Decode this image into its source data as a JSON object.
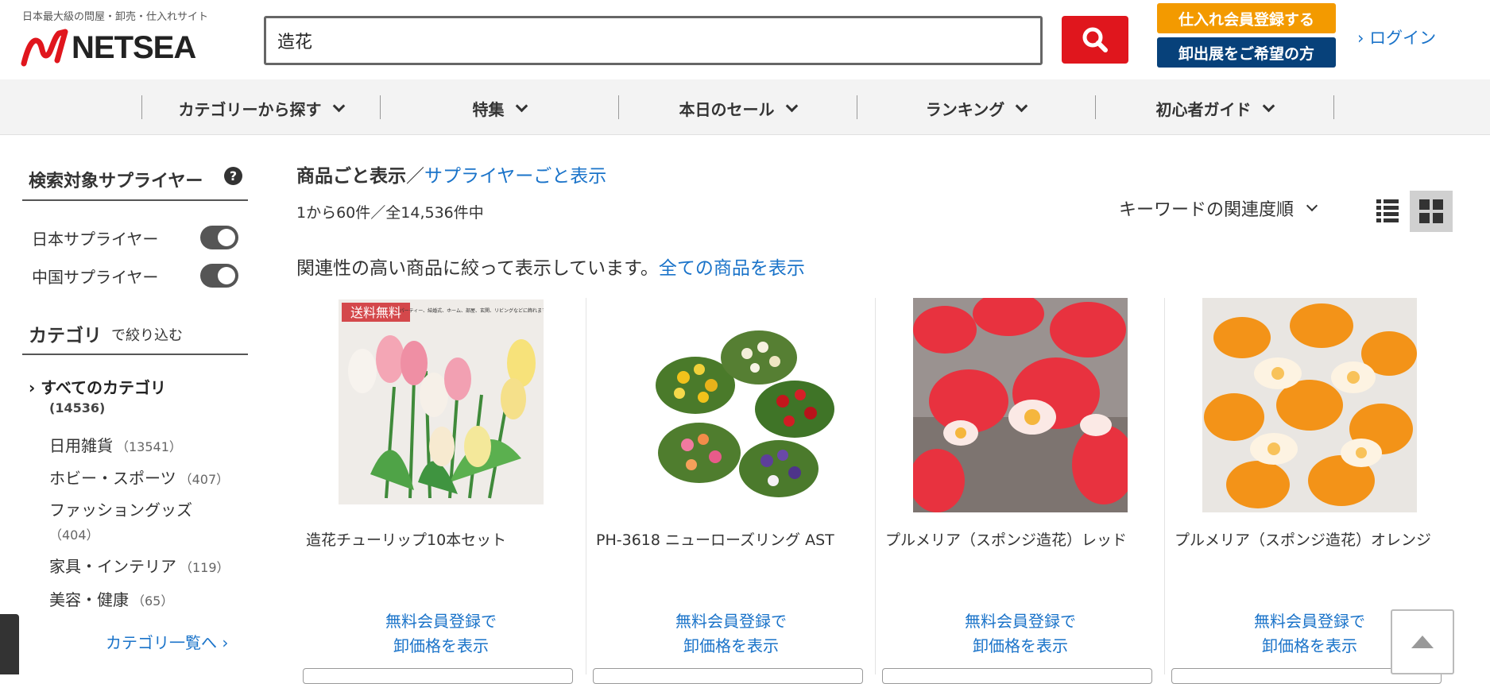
{
  "header": {
    "tagline": "日本最大級の問屋・卸売・仕入れサイト",
    "logo_text": "NETSEA",
    "search_value": "造花",
    "register_label": "仕入れ会員登録する",
    "exhibit_label": "卸出展をご希望の方",
    "login_label": "ログイン",
    "colors": {
      "search_btn": "#e0161d",
      "register_btn": "#f39a00",
      "exhibit_btn": "#07417a",
      "link": "#1a73c9"
    }
  },
  "nav": {
    "items": [
      {
        "label": "カテゴリーから探す"
      },
      {
        "label": "特集"
      },
      {
        "label": "本日のセール"
      },
      {
        "label": "ランキング"
      },
      {
        "label": "初心者ガイド"
      }
    ]
  },
  "sidebar": {
    "supplier_title": "検索対象サプライヤー",
    "help_icon": "?",
    "toggles": [
      {
        "label": "日本サプライヤー",
        "on": true
      },
      {
        "label": "中国サプライヤー",
        "on": true
      }
    ],
    "category_title": "カテゴリ",
    "category_sub": "で絞り込む",
    "all_categories": "すべてのカテゴリ",
    "all_count": "(14536)",
    "categories": [
      {
        "label": "日用雑貨",
        "count": "（13541）"
      },
      {
        "label": "ホビー・スポーツ",
        "count": "（407）"
      },
      {
        "label": "ファッショングッズ",
        "count": "（404）"
      },
      {
        "label": "家具・インテリア",
        "count": "（119）"
      },
      {
        "label": "美容・健康",
        "count": "（65）"
      }
    ],
    "more_label": "カテゴリ一覧へ"
  },
  "main": {
    "view_current": "商品ごと表示",
    "view_sep": "／",
    "view_alt": "サプライヤーごと表示",
    "result_count": "1から60件／全14,536件中",
    "sort_label": "キーワードの関連度順",
    "notice": "関連性の高い商品に絞って表示しています。",
    "notice_link": "全ての商品を表示",
    "products": [
      {
        "name": "造花チューリップ10本セット",
        "price_line1": "無料会員登録で",
        "price_line2": "卸価格を表示",
        "badge": "送料無料",
        "image_caption": "パーティー、結婚式、ホーム、部屋、玄関、リビングなどに飾れます。"
      },
      {
        "name": "PH-3618 ニューローズリング AST",
        "price_line1": "無料会員登録で",
        "price_line2": "卸価格を表示"
      },
      {
        "name": "プルメリア（スポンジ造花）レッド",
        "price_line1": "無料会員登録で",
        "price_line2": "卸価格を表示"
      },
      {
        "name": "プルメリア（スポンジ造花）オレンジ",
        "price_line1": "無料会員登録で",
        "price_line2": "卸価格を表示"
      }
    ]
  }
}
